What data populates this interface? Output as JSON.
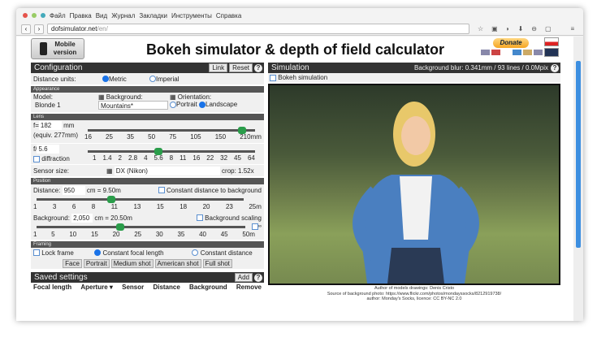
{
  "browser": {
    "menu": [
      "Файл",
      "Правка",
      "Вид",
      "Журнал",
      "Закладки",
      "Инструменты",
      "Справка"
    ],
    "url_host": "dofsimulator.net",
    "url_path": "/en/"
  },
  "header": {
    "mobile": "Mobile version",
    "title": "Bokeh simulator & depth of field calculator",
    "donate": "Donate"
  },
  "config": {
    "title": "Configuration",
    "link": "Link",
    "reset": "Reset",
    "help": "?",
    "units_label": "Distance units:",
    "metric": "Metric",
    "imperial": "Imperial",
    "appearance": "Appearance",
    "model_label": "Model:",
    "model": "Blonde 1",
    "bg_label": "Background:",
    "bg": "Mountains*",
    "orient_label": "Orientation:",
    "portrait": "Portrait",
    "landscape": "Landscape",
    "lens": "Lens",
    "f_prefix": "f=",
    "f_value": "182",
    "mm": "mm",
    "equiv": "(equiv. 277mm)",
    "focal_ticks": [
      "16",
      "25",
      "35",
      "50",
      "75",
      "105",
      "150",
      "210mm"
    ],
    "focal_pos": 0.92,
    "ap_prefix": "f/",
    "ap_value": "5.6",
    "diffraction": "diffraction",
    "ap_ticks": [
      "1",
      "1.4",
      "2",
      "2.8",
      "4",
      "5.6",
      "8",
      "11",
      "16",
      "22",
      "32",
      "45",
      "64"
    ],
    "ap_pos": 0.42,
    "sensor_label": "Sensor size:",
    "sensor": "DX (Nikon)",
    "crop": "crop: 1.52x",
    "position": "Position",
    "dist_label": "Distance:",
    "dist_value": "950",
    "dist_conv": "cm = 9.50m",
    "const_dist_bg": "Constant distance to background",
    "dist_ticks": [
      "1",
      "3",
      "6",
      "8",
      "11",
      "13",
      "15",
      "18",
      "20",
      "23",
      "25m"
    ],
    "dist_pos": 0.36,
    "bgd_label": "Background:",
    "bgd_value": "2,050",
    "bgd_conv": "cm = 20.50m",
    "bg_scaling": "Background scaling",
    "inf": "∞",
    "bgd_ticks": [
      "1",
      "5",
      "10",
      "15",
      "20",
      "25",
      "30",
      "35",
      "40",
      "45",
      "50m"
    ],
    "bgd_pos": 0.4,
    "framing": "Framing",
    "lock": "Lock frame",
    "const_focal": "Constant focal length",
    "const_distance": "Constant distance",
    "shots": [
      "Face",
      "Portrait",
      "Medium shot",
      "American shot",
      "Full shot"
    ]
  },
  "saved": {
    "title": "Saved settings",
    "add": "Add",
    "help": "?",
    "cols": [
      "Focal length",
      "Aperture ▾",
      "Sensor",
      "Distance",
      "Background",
      "Remove"
    ]
  },
  "sim": {
    "title": "Simulation",
    "blur": "Background blur: 0.341mm / 93 lines / 0.0Mpix",
    "help": "?",
    "bokeh": "Bokeh simulation",
    "credits": [
      "Author of models drawings: Denis Cristo",
      "Source of background photo: https://www.flickr.com/photos/mondayssocks/8212919738/",
      "author: Monday's Socks, licence: CC BY-NC 2.0"
    ]
  }
}
